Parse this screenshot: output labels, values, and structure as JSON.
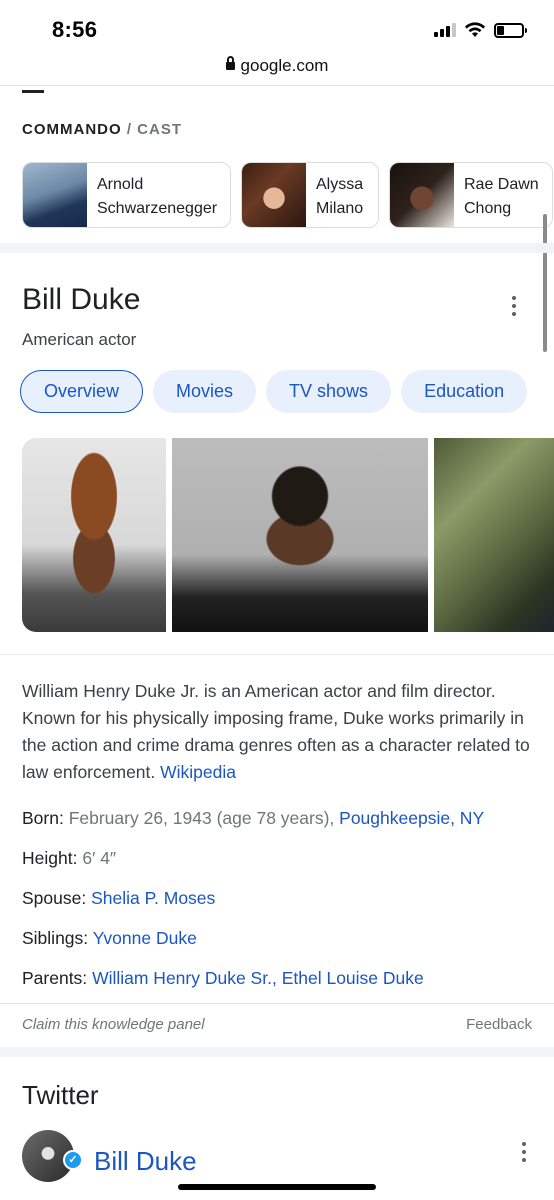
{
  "status_bar": {
    "time": "8:56",
    "icons": [
      "signal-icon",
      "wifi-icon",
      "battery-icon"
    ],
    "battery_level": 0.3
  },
  "browser": {
    "url": "google.com",
    "lock_icon": "lock-icon"
  },
  "cast": {
    "title": "COMMANDO",
    "separator": "/",
    "subtitle": "CAST",
    "members": [
      {
        "line1": "Arnold",
        "line2": "Schwarzenegger"
      },
      {
        "line1": "Alyssa",
        "line2": "Milano"
      },
      {
        "line1": "Rae Dawn",
        "line2": "Chong"
      }
    ]
  },
  "panel": {
    "title": "Bill Duke",
    "subtitle": "American actor",
    "menu_icon": "more-vert-icon",
    "tabs": [
      "Overview",
      "Movies",
      "TV shows",
      "Education"
    ],
    "active_tab": "Overview",
    "description": "William Henry Duke Jr. is an American actor and film director. Known for his physically imposing frame, Duke works primarily in the action and crime drama genres often as a character related to law enforcement.",
    "source_link": "Wikipedia",
    "facts": {
      "born": {
        "label": "Born:",
        "value": "February 26, 1943 (age 78 years),",
        "link": "Poughkeepsie, NY"
      },
      "height": {
        "label": "Height:",
        "value": "6′ 4″"
      },
      "spouse": {
        "label": "Spouse:",
        "link": "Shelia P. Moses"
      },
      "siblings": {
        "label": "Siblings:",
        "link": "Yvonne Duke"
      },
      "parents": {
        "label": "Parents:",
        "link1": "William Henry Duke Sr.",
        "sep": ",",
        "link2": "Ethel Louise Duke"
      }
    },
    "claim_text": "Claim this knowledge panel",
    "feedback_text": "Feedback"
  },
  "twitter": {
    "title": "Twitter",
    "account_name": "Bill Duke",
    "verified_icon": "verified-badge-icon",
    "menu_icon": "more-vert-icon"
  },
  "colors": {
    "link": "#1a56c4",
    "chip_bg": "#e8f0fe",
    "text": "#202124",
    "muted": "#70757a"
  }
}
